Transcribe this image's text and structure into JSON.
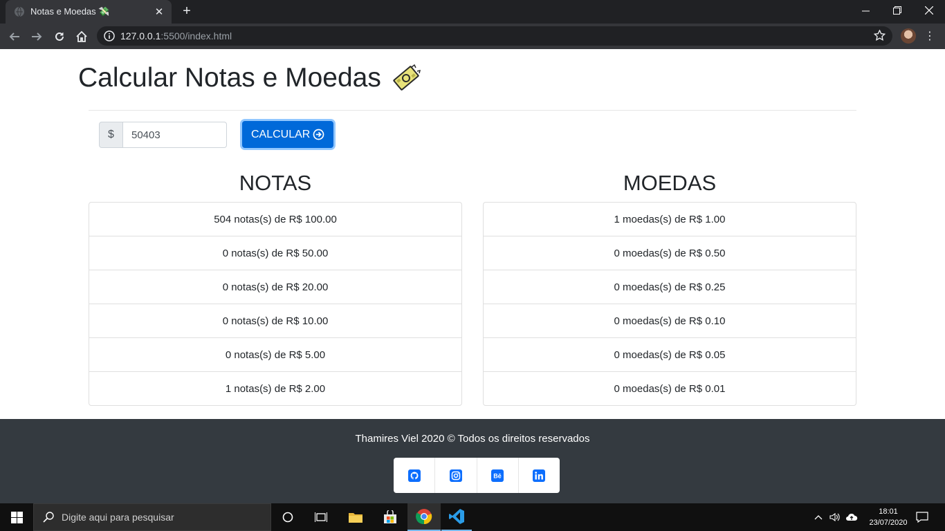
{
  "browser": {
    "tab_title": "Notas e Moedas 💸",
    "tab_close": "✕",
    "new_tab": "+",
    "url_host": "127.0.0.1",
    "url_rest": ":5500/index.html"
  },
  "page": {
    "title": "Calcular Notas e Moedas",
    "currency_prefix": "$",
    "amount_value": "50403",
    "calc_button_label": "CALCULAR",
    "notas_title": "NOTAS",
    "moedas_title": "MOEDAS",
    "notas": [
      "504 notas(s) de R$ 100.00",
      "0 notas(s) de R$ 50.00",
      "0 notas(s) de R$ 20.00",
      "0 notas(s) de R$ 10.00",
      "0 notas(s) de R$ 5.00",
      "1 notas(s) de R$ 2.00"
    ],
    "moedas": [
      "1 moedas(s) de R$ 1.00",
      "0 moedas(s) de R$ 0.50",
      "0 moedas(s) de R$ 0.25",
      "0 moedas(s) de R$ 0.10",
      "0 moedas(s) de R$ 0.05",
      "0 moedas(s) de R$ 0.01"
    ]
  },
  "footer": {
    "copyright": "Thamires Viel 2020 © Todos os direitos reservados",
    "socials": [
      "github-icon",
      "instagram-icon",
      "behance-icon",
      "linkedin-icon"
    ]
  },
  "taskbar": {
    "search_placeholder": "Digite aqui para pesquisar",
    "time": "18:01",
    "date": "23/07/2020"
  },
  "colors": {
    "primary": "#0069d9",
    "footer_bg": "#343a40",
    "social_icon": "#0d6efd"
  }
}
